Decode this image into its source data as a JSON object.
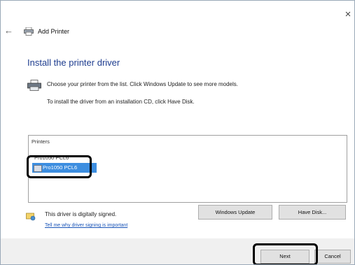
{
  "window": {
    "close_glyph": "×",
    "back_glyph": "←",
    "title": "Add Printer"
  },
  "main": {
    "heading": "Install the printer driver",
    "description_line1": "Choose your printer from the list. Click Windows Update to see more models.",
    "description_line2": "To install the driver from an installation CD, click Have Disk."
  },
  "printers_list": {
    "header": "Printers",
    "items": [
      {
        "label": "Pro1050 PCL6",
        "selected": false
      },
      {
        "label": "Pro1050 PCL6",
        "selected": true
      }
    ]
  },
  "signing": {
    "text": "This driver is digitally signed.",
    "link": "Tell me why driver signing is important"
  },
  "buttons": {
    "windows_update": "Windows Update",
    "have_disk": "Have Disk...",
    "next": "Next",
    "cancel": "Cancel"
  },
  "colors": {
    "heading": "#1e3d8f",
    "selection": "#3d8ee0",
    "link": "#1a55b8",
    "annotation": "#000000"
  }
}
